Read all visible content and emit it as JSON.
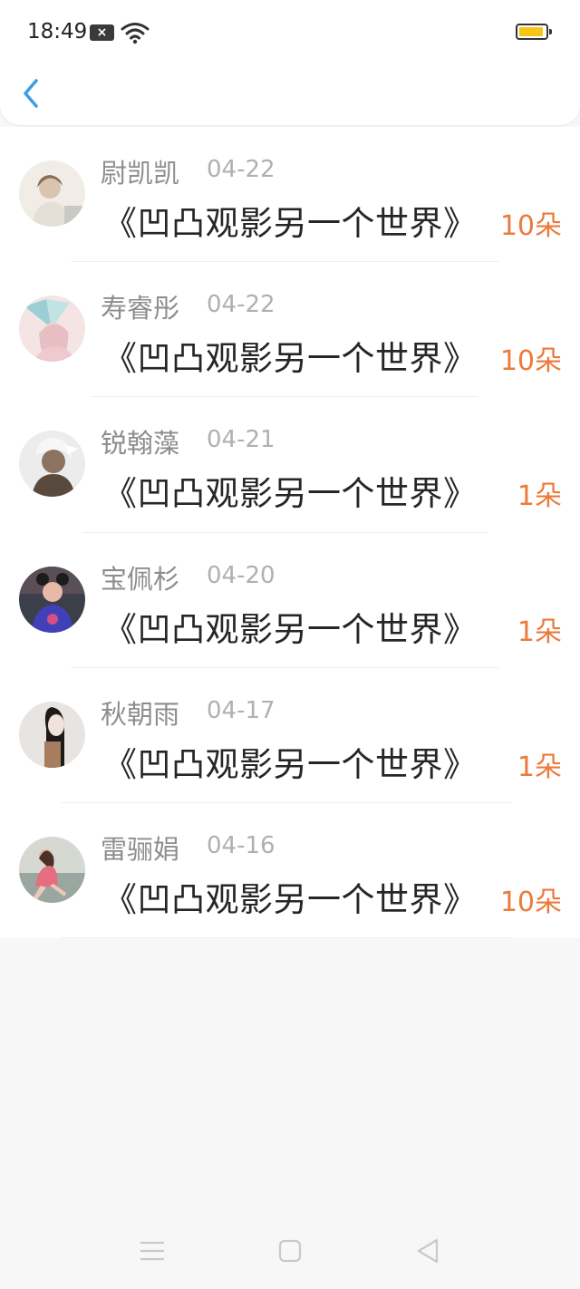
{
  "status_bar": {
    "time": "18:49"
  },
  "gifts": [
    {
      "name": "尉凯凯",
      "date": "04-22",
      "gift": "《凹凸观影另一个世界》",
      "amount": "10朵"
    },
    {
      "name": "寿睿彤",
      "date": "04-22",
      "gift": "《凹凸观影另一个世界》",
      "amount": "10朵"
    },
    {
      "name": "锐翰藻",
      "date": "04-21",
      "gift": "《凹凸观影另一个世界》",
      "amount": "1朵"
    },
    {
      "name": "宝佩杉",
      "date": "04-20",
      "gift": "《凹凸观影另一个世界》",
      "amount": "1朵"
    },
    {
      "name": "秋朝雨",
      "date": "04-17",
      "gift": "《凹凸观影另一个世界》",
      "amount": "1朵"
    },
    {
      "name": "雷骊娟",
      "date": "04-16",
      "gift": "《凹凸观影另一个世界》",
      "amount": "10朵"
    }
  ],
  "colors": {
    "accent": "#3a9ee6",
    "amount": "#ec7a3a",
    "name": "#8d8d8d",
    "battery": "#f5c518"
  }
}
